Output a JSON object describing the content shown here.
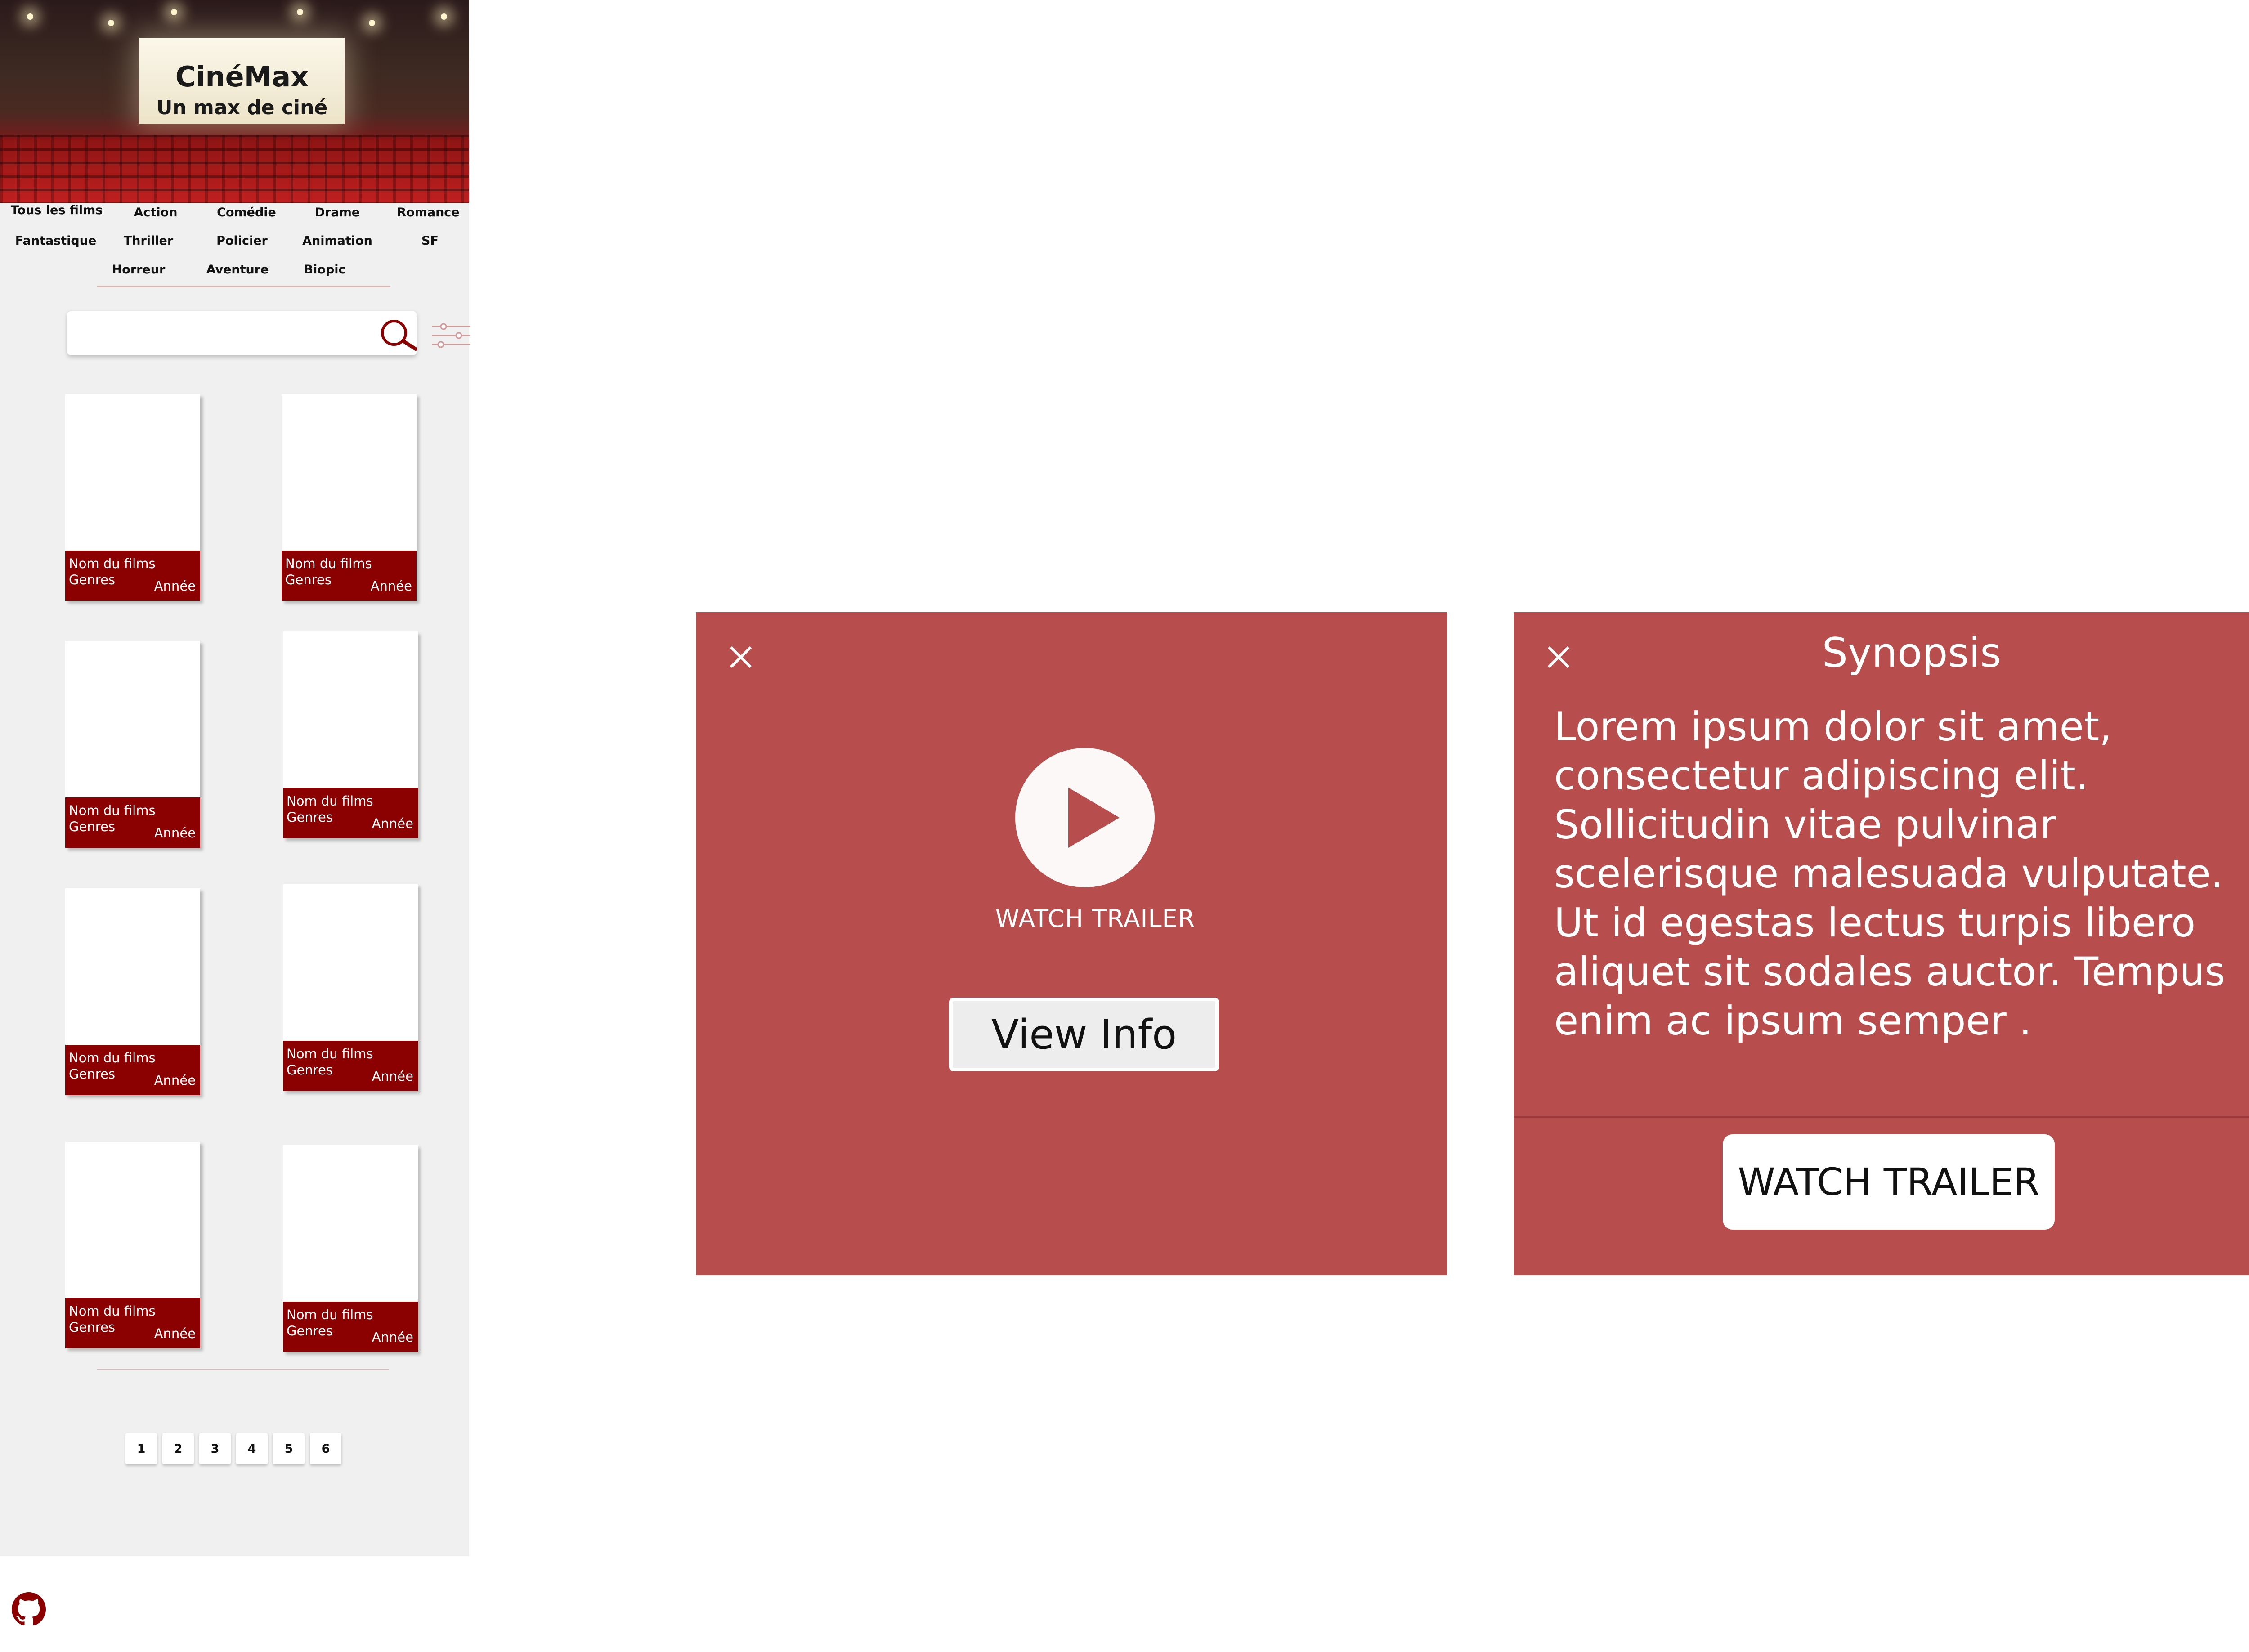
{
  "brand": {
    "name": "CinéMax",
    "tagline": "Un max de ciné"
  },
  "genres": [
    "Tous les films",
    "Action",
    "Comédie",
    "Drame",
    "Romance",
    "Fantastique",
    "Thriller",
    "Policier",
    "Animation",
    "SF",
    "Horreur",
    "Aventure",
    "Biopic"
  ],
  "search": {
    "value": "",
    "placeholder": ""
  },
  "movies": [
    {
      "name": "Nom du films",
      "genres": "Genres",
      "year": "Année"
    },
    {
      "name": "Nom du films",
      "genres": "Genres",
      "year": "Année"
    },
    {
      "name": "Nom du films",
      "genres": "Genres",
      "year": "Année"
    },
    {
      "name": "Nom du films",
      "genres": "Genres",
      "year": "Année"
    },
    {
      "name": "Nom du films",
      "genres": "Genres",
      "year": "Année"
    },
    {
      "name": "Nom du films",
      "genres": "Genres",
      "year": "Année"
    },
    {
      "name": "Nom du films",
      "genres": "Genres",
      "year": "Année"
    },
    {
      "name": "Nom du films",
      "genres": "Genres",
      "year": "Année"
    }
  ],
  "pagination": [
    "1",
    "2",
    "3",
    "4",
    "5",
    "6"
  ],
  "icons": {
    "search": "search-icon",
    "filter": "filter-icon",
    "github": "github-icon",
    "close": "close-icon",
    "play": "play-icon"
  },
  "colors": {
    "brand_red": "#8b0000",
    "modal_bg": "#b84d4d",
    "panel_bg": "#f0f0f0"
  },
  "trailer_modal": {
    "watch_label": "WATCH TRAILER",
    "view_info_label": "View Info"
  },
  "synopsis_modal": {
    "title": "Synopsis",
    "text": "Lorem ipsum dolor sit amet, consectetur adipiscing elit. Sollicitudin vitae pulvinar scelerisque malesuada vulputate. Ut id egestas lectus turpis libero aliquet sit sodales auctor. Tempus enim ac ipsum semper .",
    "button_label": "WATCH TRAILER"
  }
}
